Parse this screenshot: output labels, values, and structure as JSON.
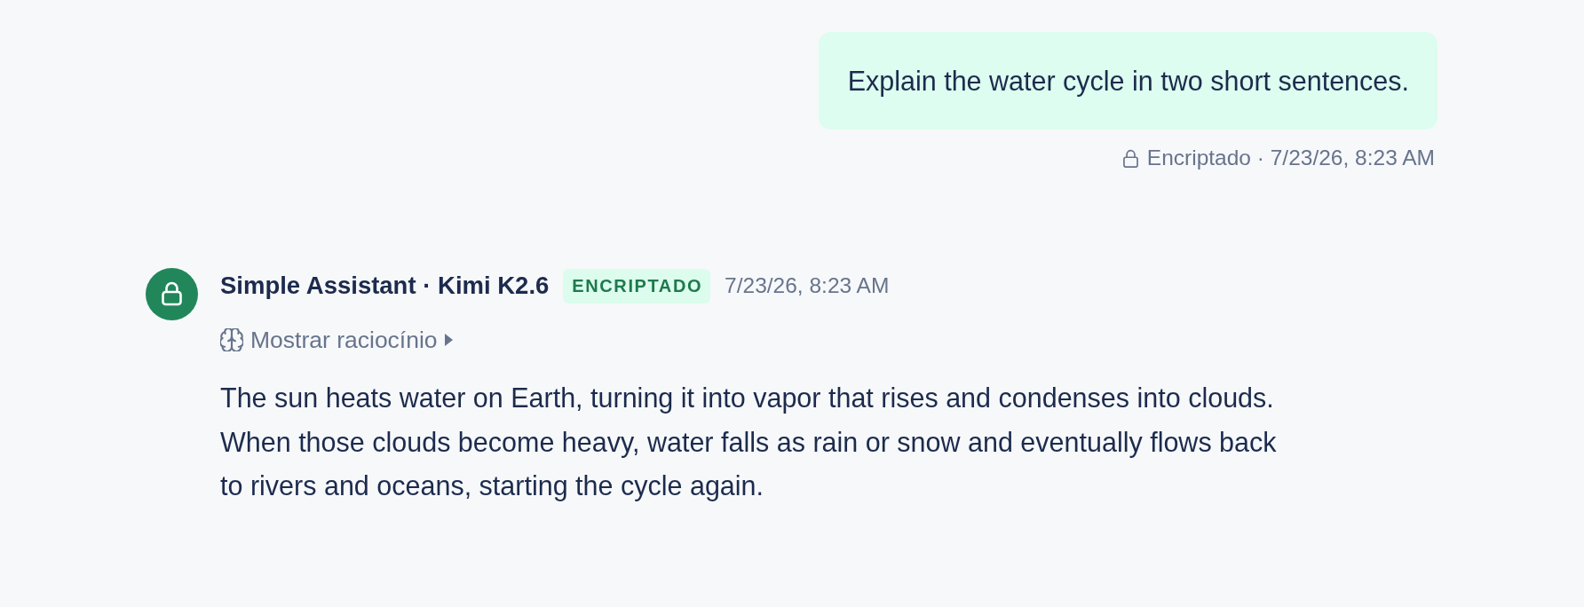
{
  "user_message": {
    "text": "Explain the water cycle in two short sentences.",
    "meta": "Encriptado · 7/23/26, 8:23 AM"
  },
  "assistant_message": {
    "sender": "Simple Assistant · Kimi K2.6",
    "badge": "ENCRIPTADO",
    "time": "7/23/26, 8:23 AM",
    "reasoning_toggle": {
      "label": "Mostrar raciocínio",
      "expanded": false
    },
    "text": "The sun heats water on Earth, turning it into vapor that rises and condenses into clouds. When those clouds become heavy, water falls as rain or snow and eventually flows back to rivers and oceans, starting the cycle again."
  }
}
